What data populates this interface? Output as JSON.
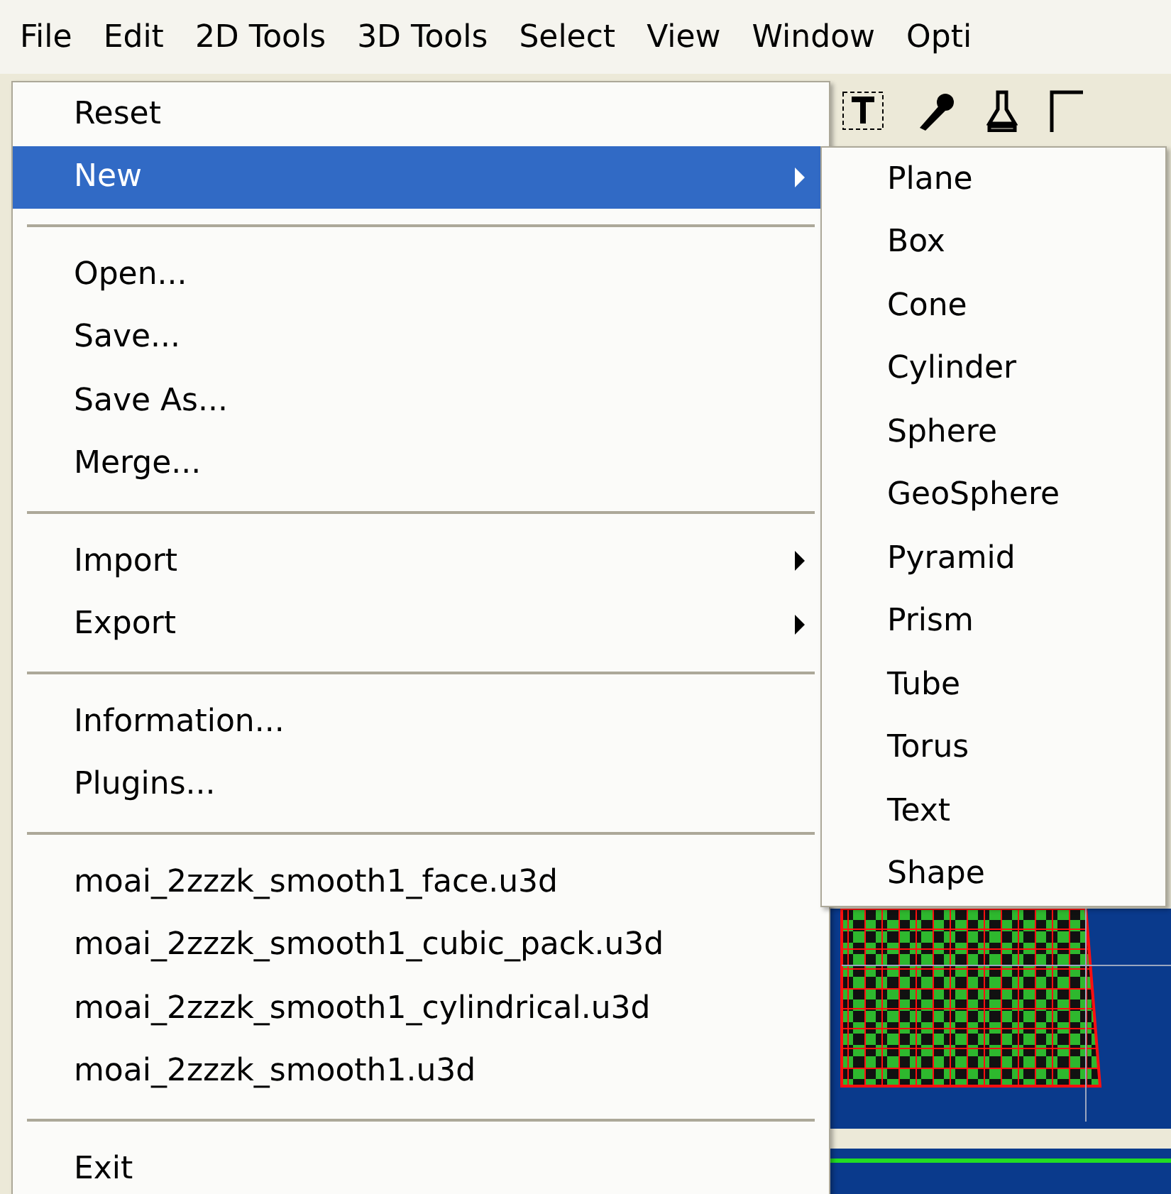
{
  "menu_bar": [
    {
      "label": "File"
    },
    {
      "label": "Edit"
    },
    {
      "label": "2D Tools"
    },
    {
      "label": "3D Tools"
    },
    {
      "label": "Select"
    },
    {
      "label": "View"
    },
    {
      "label": "Window"
    },
    {
      "label": "Opti"
    }
  ],
  "file_menu": [
    {
      "kind": "item",
      "label": "Reset",
      "submenu": false,
      "selected": false
    },
    {
      "kind": "item",
      "label": "New",
      "submenu": true,
      "selected": true
    },
    {
      "kind": "separator"
    },
    {
      "kind": "item",
      "label": "Open...",
      "submenu": false,
      "selected": false
    },
    {
      "kind": "item",
      "label": "Save...",
      "submenu": false,
      "selected": false
    },
    {
      "kind": "item",
      "label": "Save As...",
      "submenu": false,
      "selected": false
    },
    {
      "kind": "item",
      "label": "Merge...",
      "submenu": false,
      "selected": false
    },
    {
      "kind": "separator"
    },
    {
      "kind": "item",
      "label": "Import",
      "submenu": true,
      "selected": false
    },
    {
      "kind": "item",
      "label": "Export",
      "submenu": true,
      "selected": false
    },
    {
      "kind": "separator"
    },
    {
      "kind": "item",
      "label": "Information...",
      "submenu": false,
      "selected": false
    },
    {
      "kind": "item",
      "label": "Plugins...",
      "submenu": false,
      "selected": false
    },
    {
      "kind": "separator"
    },
    {
      "kind": "item",
      "label": "moai_2zzzk_smooth1_face.u3d",
      "submenu": false,
      "selected": false
    },
    {
      "kind": "item",
      "label": "moai_2zzzk_smooth1_cubic_pack.u3d",
      "submenu": false,
      "selected": false
    },
    {
      "kind": "item",
      "label": "moai_2zzzk_smooth1_cylindrical.u3d",
      "submenu": false,
      "selected": false
    },
    {
      "kind": "item",
      "label": "moai_2zzzk_smooth1.u3d",
      "submenu": false,
      "selected": false
    },
    {
      "kind": "separator"
    },
    {
      "kind": "item",
      "label": "Exit",
      "submenu": false,
      "selected": false
    }
  ],
  "new_submenu": [
    {
      "label": "Plane"
    },
    {
      "label": "Box"
    },
    {
      "label": "Cone"
    },
    {
      "label": "Cylinder"
    },
    {
      "label": "Sphere"
    },
    {
      "label": "GeoSphere"
    },
    {
      "label": "Pyramid"
    },
    {
      "label": "Prism"
    },
    {
      "label": "Tube"
    },
    {
      "label": "Torus"
    },
    {
      "label": "Text"
    },
    {
      "label": "Shape"
    }
  ]
}
